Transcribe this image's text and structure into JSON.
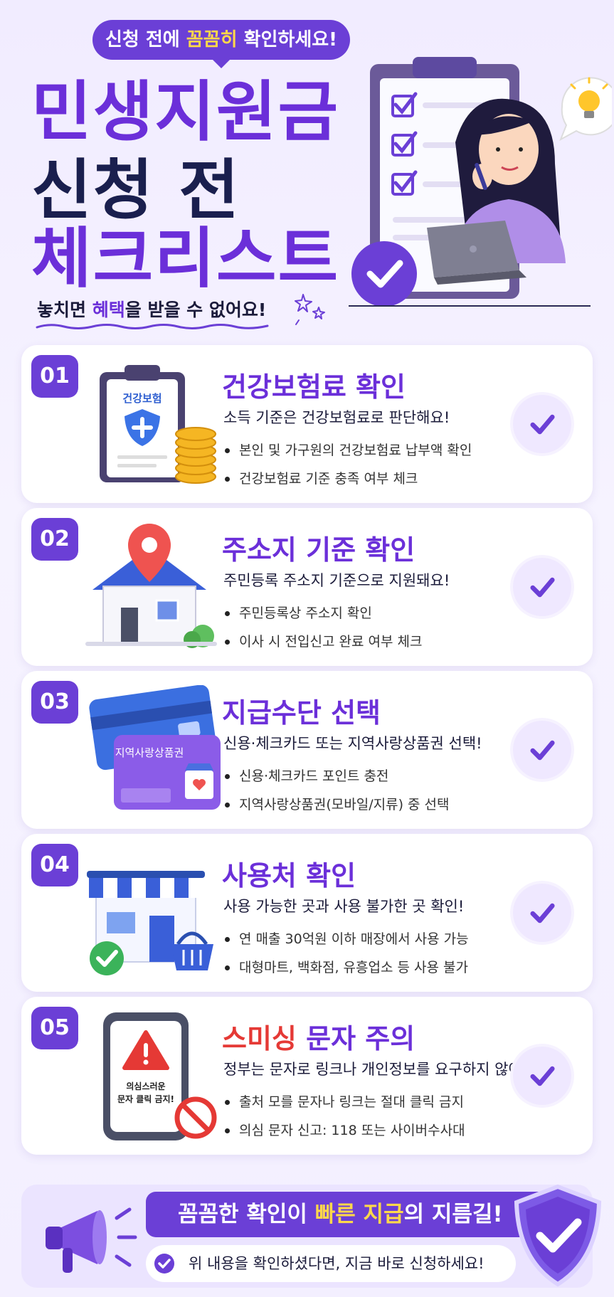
{
  "header": {
    "pill_pre": "신청 전에 ",
    "pill_highlight": "꼼꼼히",
    "pill_post": " 확인하세요!",
    "title_line1": "민생지원금",
    "title_line2": "신청 전",
    "title_line3": "체크리스트",
    "subtitle_pre": "놓치면 ",
    "subtitle_highlight": "혜택",
    "subtitle_post": "을 받을 수 없어요!"
  },
  "cards": [
    {
      "number": "01",
      "title": "건강보험료 확인",
      "illustration_label": "건강보험",
      "desc": "소득 기준은 건강보험료로 판단해요!",
      "bullets": [
        "본인 및 가구원의 건강보험료 납부액 확인",
        "건강보험료 기준 충족 여부 체크"
      ]
    },
    {
      "number": "02",
      "title": "주소지 기준 확인",
      "desc": "주민등록 주소지 기준으로 지원돼요!",
      "bullets": [
        "주민등록상 주소지 확인",
        "이사 시 전입신고 완료 여부 체크"
      ]
    },
    {
      "number": "03",
      "title": "지급수단 선택",
      "illustration_label": "지역사랑상품권",
      "desc": "신용·체크카드 또는 지역사랑상품권 선택!",
      "bullets": [
        "신용·체크카드 포인트 충전",
        "지역사랑상품권(모바일/지류) 중 선택"
      ]
    },
    {
      "number": "04",
      "title": "사용처 확인",
      "desc": "사용 가능한 곳과 사용 불가한 곳 확인!",
      "bullets": [
        "연 매출 30억원 이하 매장에서 사용 가능",
        "대형마트, 백화점, 유흥업소 등 사용 불가"
      ]
    },
    {
      "number": "05",
      "title_red": "스미싱",
      "title_rest": " 문자 주의",
      "illustration_label_1": "의심스러운",
      "illustration_label_2": "문자 클릭 금지!",
      "desc": "정부는 문자로 링크나 개인정보를 요구하지 않아요!",
      "bullets": [
        "출처 모를 문자나 링크는 절대 클릭 금지",
        "의심 문자 신고: 118 또는 사이버수사대"
      ]
    }
  ],
  "footer": {
    "banner_pre": "꼼꼼한 확인이 ",
    "banner_highlight": "빠른 지급",
    "banner_post": "의 지름길!",
    "note": "위 내용을 확인하셨다면, 지금 바로 신청하세요!"
  },
  "colors": {
    "primary": "#6b3fd6",
    "title_purple": "#6b2fd9",
    "navy": "#1a1f4e",
    "highlight_yellow": "#ffd84a",
    "warning_red": "#e53935",
    "background": "#f3efff"
  },
  "icons": [
    "clipboard-icon",
    "woman-with-laptop",
    "lightbulb-icon",
    "insurance-clipboard-icon",
    "coins-icon",
    "house-icon",
    "location-pin-icon",
    "credit-card-icon",
    "gift-voucher-card-icon",
    "store-icon",
    "shopping-basket-icon",
    "smartphone-icon",
    "warning-icon",
    "no-entry-icon",
    "check-circle-icon",
    "megaphone-icon",
    "shield-check-icon"
  ]
}
